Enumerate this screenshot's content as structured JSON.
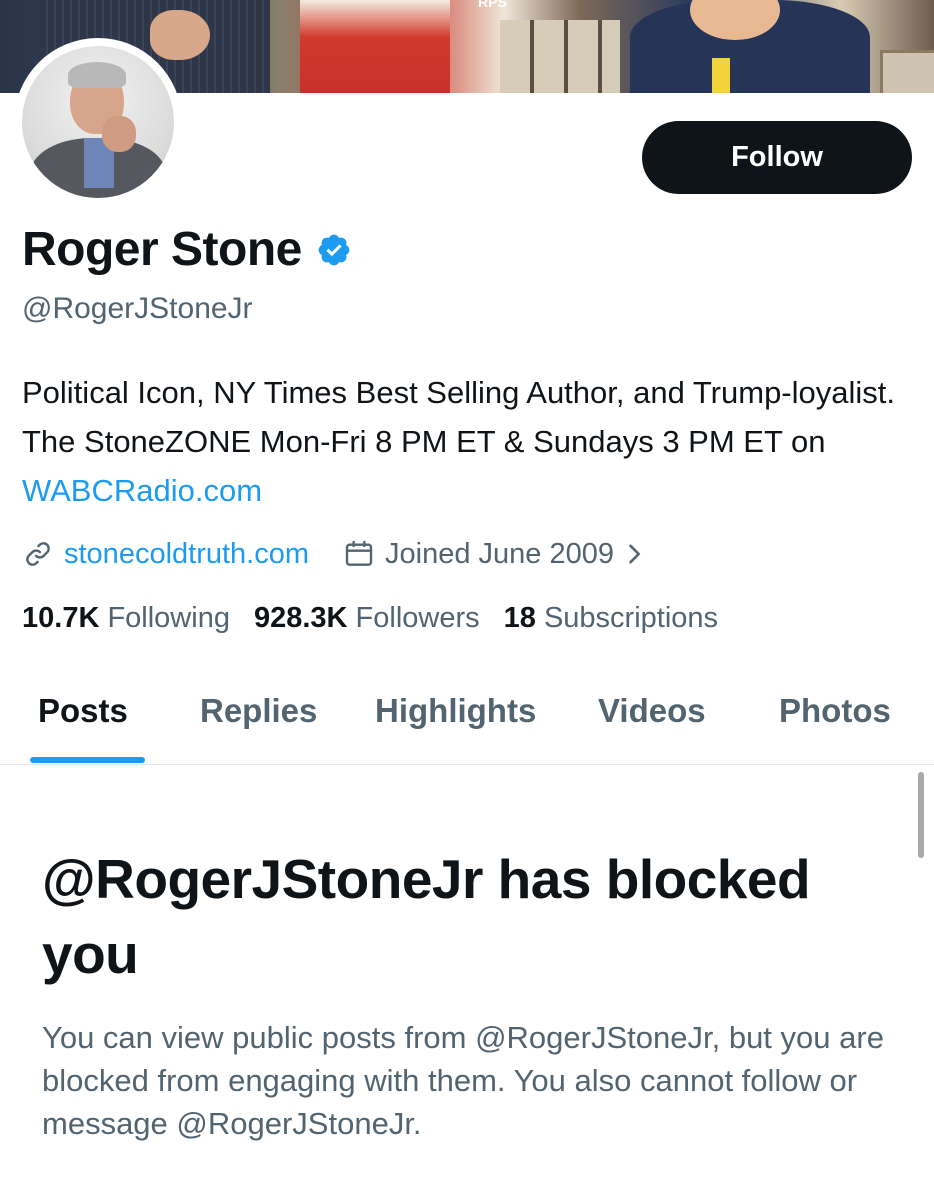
{
  "banner": {
    "text": "RPS"
  },
  "profile": {
    "name": "Roger Stone",
    "handle": "@RogerJStoneJr",
    "verified": true,
    "bio_text": "Political Icon, NY Times Best Selling Author, and Trump-loyalist. The StoneZONE Mon-Fri 8 PM ET & Sundays 3 PM ET on ",
    "bio_link": "WABCRadio.com",
    "website": "stonecoldtruth.com",
    "joined": "Joined June 2009"
  },
  "actions": {
    "follow_label": "Follow"
  },
  "stats": {
    "following_count": "10.7K",
    "following_label": "Following",
    "followers_count": "928.3K",
    "followers_label": "Followers",
    "subscriptions_count": "18",
    "subscriptions_label": "Subscriptions"
  },
  "tabs": [
    {
      "label": "Posts",
      "active": true
    },
    {
      "label": "Replies",
      "active": false
    },
    {
      "label": "Highlights",
      "active": false
    },
    {
      "label": "Videos",
      "active": false
    },
    {
      "label": "Photos",
      "active": false
    }
  ],
  "blocked": {
    "title": "@RogerJStoneJr has blocked you",
    "description": "You can view public posts from @RogerJStoneJr, but you are blocked from engaging with them. You also cannot follow or message @RogerJStoneJr."
  },
  "colors": {
    "accent": "#1d9bf0",
    "text_primary": "#0f1419",
    "text_secondary": "#536471",
    "button_bg": "#0f1419"
  }
}
